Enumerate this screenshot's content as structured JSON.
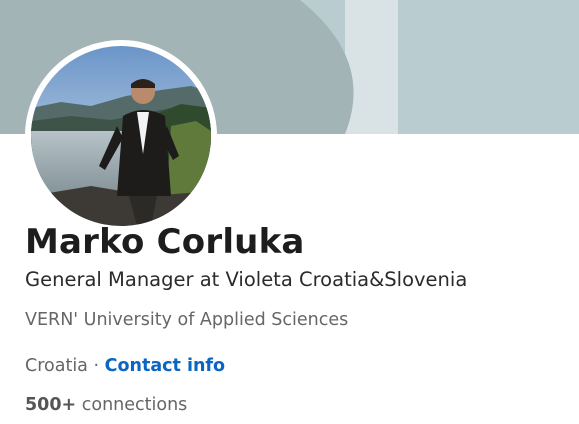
{
  "profile": {
    "name": "Marko Corluka",
    "headline": "General Manager at Violeta Croatia&Slovenia",
    "school": "VERN' University of Applied Sciences",
    "location": "Croatia",
    "separator": " · ",
    "contact_info_label": "Contact info",
    "connections_count": "500+",
    "connections_label": " connections"
  },
  "theme": {
    "banner_base": "#b9ccd0",
    "banner_shape_dark": "#a2b4b6",
    "banner_band_light": "#d9e3e5",
    "link_color": "#0a66c2"
  },
  "icons": {
    "avatar": "profile-photo"
  }
}
